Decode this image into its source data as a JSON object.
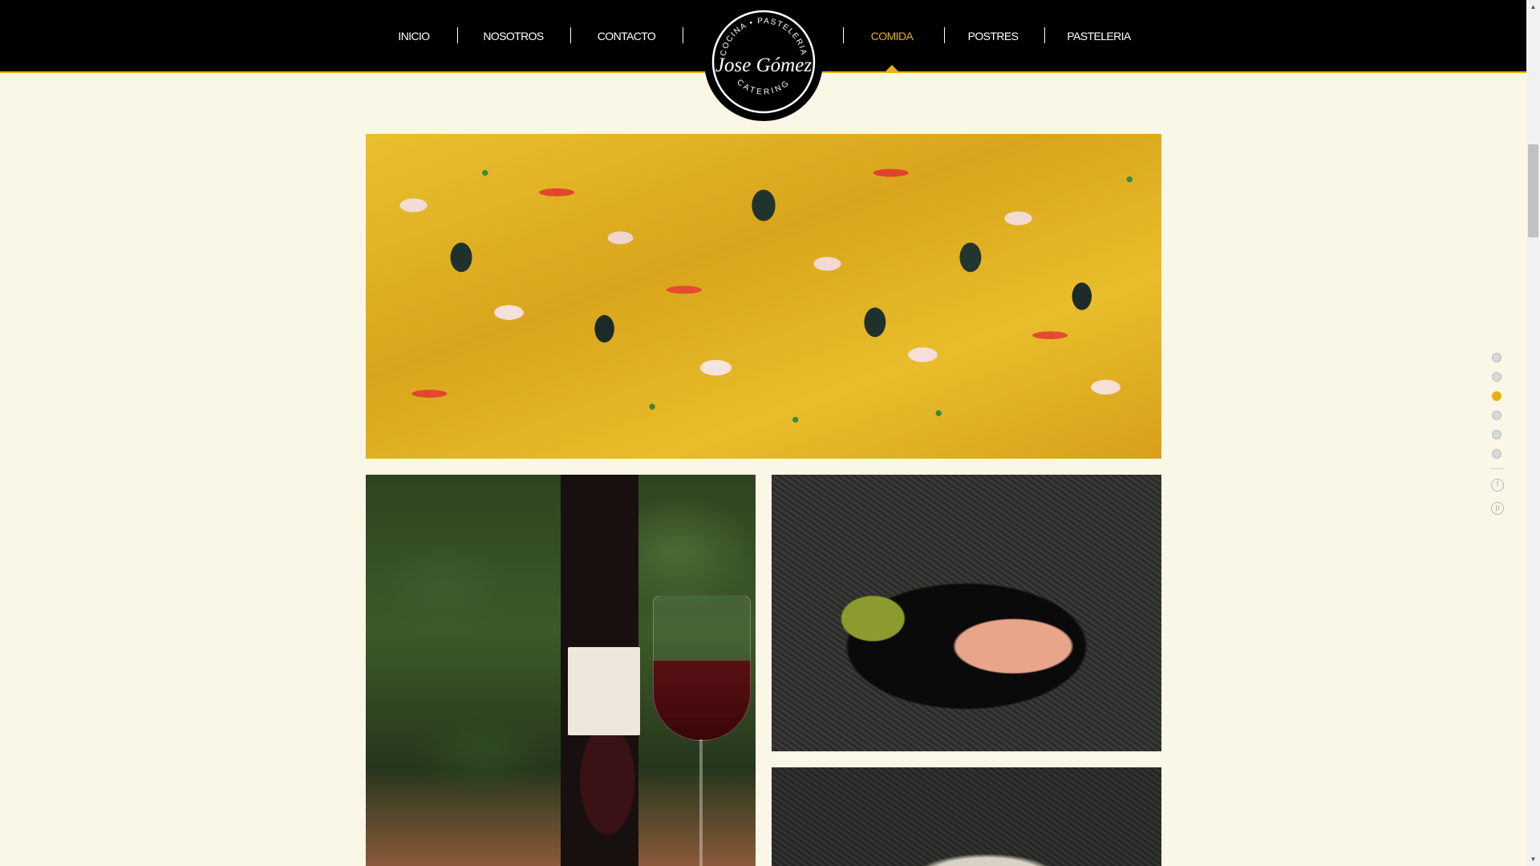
{
  "nav": {
    "left": [
      {
        "label": "INICIO"
      },
      {
        "label": "NOSOTROS"
      },
      {
        "label": "CONTACTO"
      }
    ],
    "right": [
      {
        "label": "COMIDA",
        "active": true
      },
      {
        "label": "POSTRES"
      },
      {
        "label": "PASTELERIA"
      }
    ]
  },
  "logo": {
    "top_text": "COCINA • PASTELERIA",
    "name": "Jose Gómez",
    "bottom_text": "CATERING"
  },
  "gallery": [
    {
      "subject": "paella"
    },
    {
      "subject": "wine"
    },
    {
      "subject": "salmon"
    },
    {
      "subject": "plated-dish"
    }
  ],
  "page_nav": {
    "dots": 6,
    "active_index": 2,
    "social": [
      {
        "icon": "facebook-icon",
        "glyph": "f"
      },
      {
        "icon": "pinterest-icon",
        "glyph": "p"
      }
    ]
  },
  "colors": {
    "accent": "#e6b10f",
    "header_bg": "#000000",
    "page_bg": "#fbf7e7"
  },
  "scrollbar": {
    "up": "▲",
    "down": "▼"
  }
}
